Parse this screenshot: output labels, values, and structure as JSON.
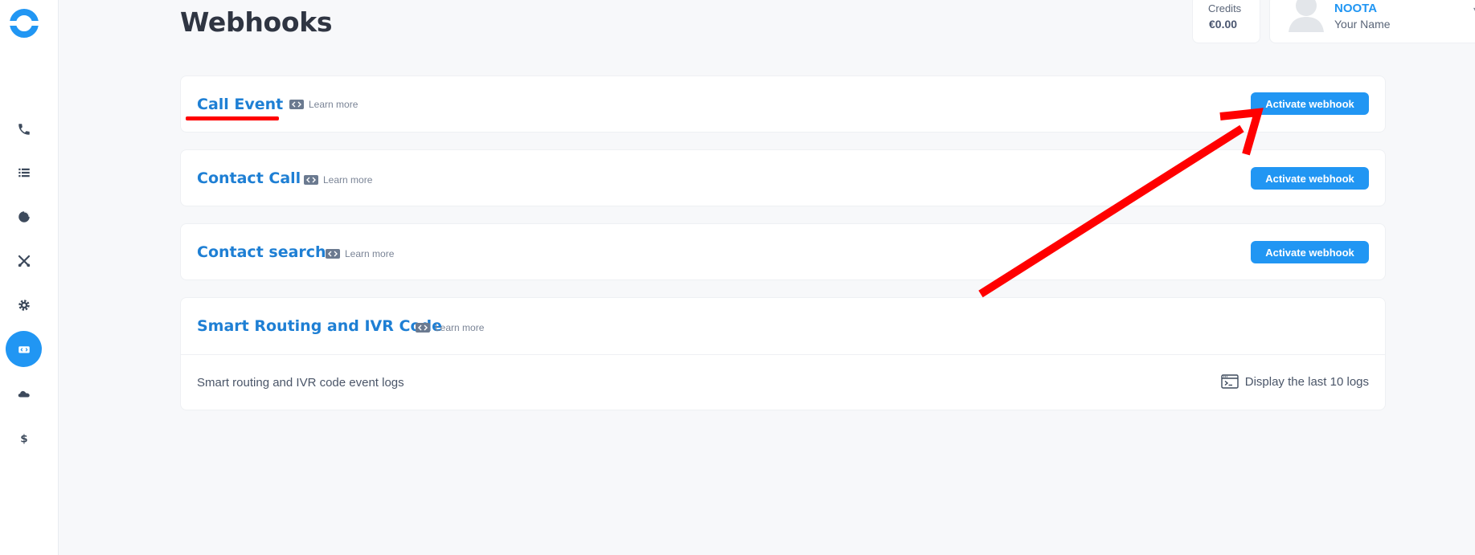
{
  "page": {
    "title": "Webhooks"
  },
  "header": {
    "credits_label": "Credits",
    "credits_value": "€0.00",
    "company": "NOOTA",
    "user_name": "Your Name"
  },
  "sidebar": {
    "items": [
      {
        "name": "phone-icon"
      },
      {
        "name": "list-icon"
      },
      {
        "name": "pie-chart-icon"
      },
      {
        "name": "tools-icon"
      },
      {
        "name": "gear-icon"
      },
      {
        "name": "code-icon",
        "active": true
      },
      {
        "name": "cloud-icon"
      },
      {
        "name": "dollar-icon"
      }
    ]
  },
  "webhooks": [
    {
      "title": "Call Event",
      "learn_more": "Learn more",
      "button": "Activate webhook"
    },
    {
      "title": "Contact Call",
      "learn_more": "Learn more",
      "button": "Activate webhook"
    },
    {
      "title": "Contact search",
      "learn_more": "Learn more",
      "button": "Activate webhook"
    },
    {
      "title": "Smart Routing and IVR Code",
      "learn_more": "Learn more",
      "logs_label": "Smart routing and IVR code event logs",
      "logs_link": "Display the last 10 logs"
    }
  ],
  "colors": {
    "accent": "#2196f3",
    "title_blue": "#1e7fd4",
    "annotation": "#ff0000"
  }
}
